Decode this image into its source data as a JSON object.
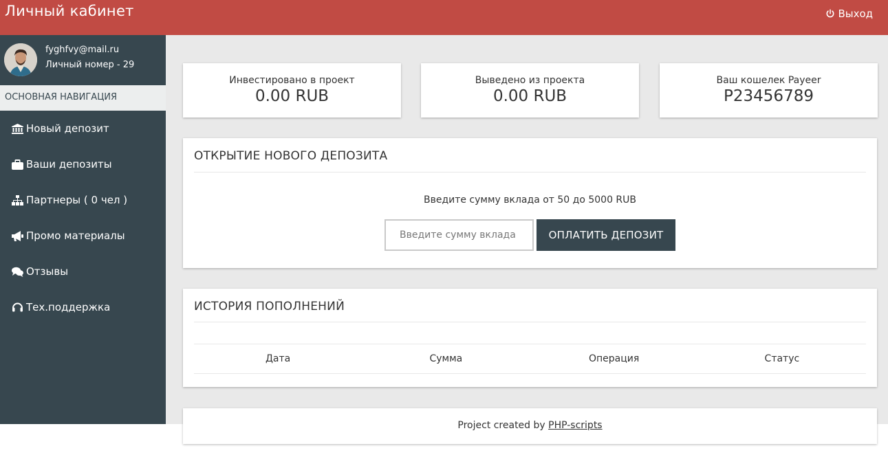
{
  "header": {
    "title": "Личный кабинет",
    "logout_label": "Выход",
    "logout_icon": "power-icon",
    "color": "#c14b44"
  },
  "user": {
    "email": "fyghfvy@mail.ru",
    "personal_number": "Личный номер - 29"
  },
  "sidebar": {
    "section_title": "ОСНОВНАЯ НАВИГАЦИЯ",
    "color": "#37474f",
    "items": [
      {
        "label": "Новый депозит",
        "icon": "bank-icon"
      },
      {
        "label": "Ваши депозиты",
        "icon": "briefcase-icon"
      },
      {
        "label": "Партнеры ( 0 чел )",
        "icon": "sitemap-icon"
      },
      {
        "label": "Промо материалы",
        "icon": "megaphone-icon"
      },
      {
        "label": "Отзывы",
        "icon": "comments-icon"
      },
      {
        "label": "Тех.поддержка",
        "icon": "headset-icon"
      }
    ]
  },
  "stats": [
    {
      "label": "Инвестировано в проект",
      "value": "0.00 RUB"
    },
    {
      "label": "Выведено из проекта",
      "value": "0.00 RUB"
    },
    {
      "label": "Ваш кошелек Payeer",
      "value": "P23456789"
    }
  ],
  "deposit": {
    "title": "ОТКРЫТИЕ НОВОГО ДЕПОЗИТА",
    "hint": "Введите сумму вклада от 50 до 5000 RUB",
    "input_placeholder": "Введите сумму вклада",
    "input_value": "",
    "button_label": "ОПЛАТИТЬ ДЕПОЗИТ"
  },
  "history": {
    "title": "ИСТОРИЯ ПОПОЛНЕНИЙ",
    "columns": [
      "Дата",
      "Сумма",
      "Операция",
      "Статус"
    ],
    "rows": []
  },
  "footer": {
    "text": "Project created by",
    "link_label": "PHP-scripts"
  }
}
